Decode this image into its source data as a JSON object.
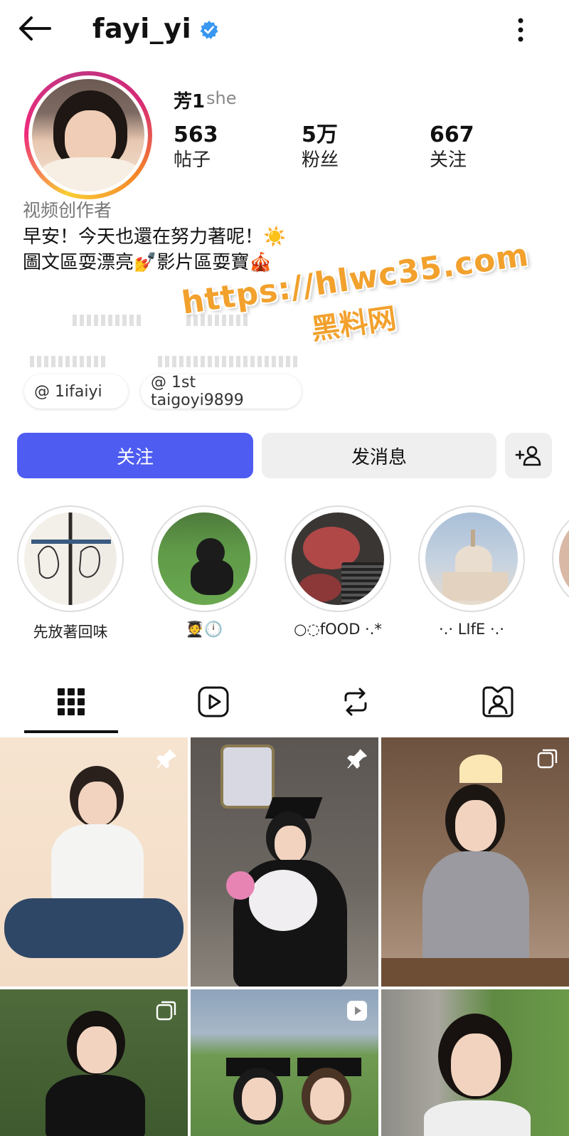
{
  "header": {
    "username": "fayi_yi",
    "verified_icon": "verified-badge-icon",
    "back_icon": "arrow-left-icon",
    "more_icon": "more-vertical-icon"
  },
  "profile": {
    "display_name": "芳1",
    "pronoun": "she",
    "stats": [
      {
        "value": "563",
        "label": "帖子"
      },
      {
        "value": "5万",
        "label": "粉丝"
      },
      {
        "value": "667",
        "label": "关注"
      }
    ],
    "category": "视频创作者",
    "bio_line1": "早安！今天也還在努力著呢！☀️",
    "bio_line2": "圖文區耍漂亮💅影片區耍寶🎪",
    "chips": [
      "@ 1ifaiyi",
      "@ 1st taigoyi9899"
    ]
  },
  "watermark": {
    "url": "https://hlwc35.com",
    "title": "黑料网"
  },
  "actions": {
    "follow_label": "关注",
    "message_label": "发消息",
    "suggest_icon": "add-person-icon"
  },
  "highlights": [
    {
      "label": "先放著回味"
    },
    {
      "label": "🧑‍🎓🕛"
    },
    {
      "label": "○◌fOOD ·.*"
    },
    {
      "label": "·.· LIfE ·.·"
    }
  ],
  "tabs": [
    {
      "icon": "grid-icon"
    },
    {
      "icon": "reels-icon"
    },
    {
      "icon": "repost-icon"
    },
    {
      "icon": "tagged-icon"
    }
  ],
  "colors": {
    "accent": "#4e5cf1",
    "verified": "#3897f0",
    "watermark": "#f2a12d"
  }
}
